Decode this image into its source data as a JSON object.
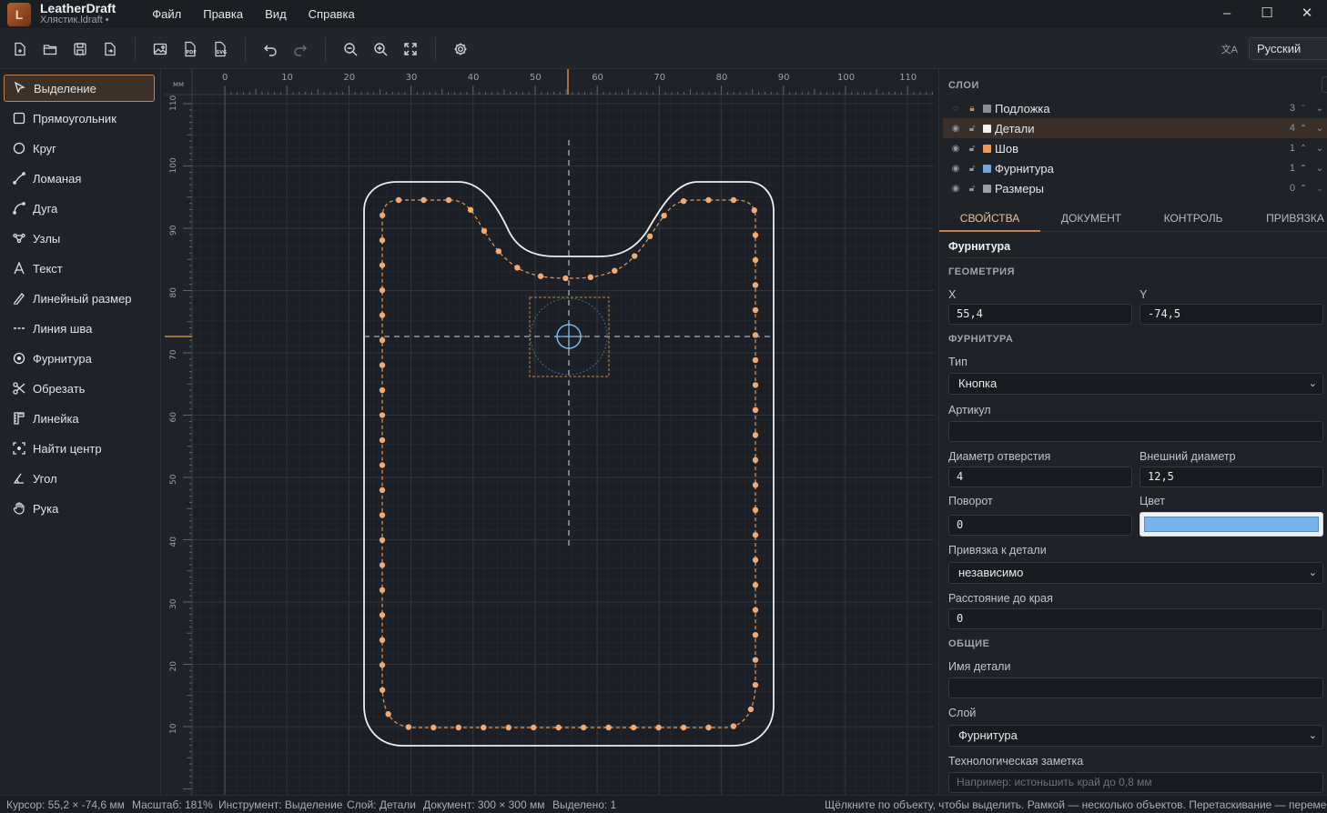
{
  "app": {
    "name": "LeatherDraft",
    "file": "Хлястик.ldraft •"
  },
  "menu": [
    "Файл",
    "Правка",
    "Вид",
    "Справка"
  ],
  "window_buttons": [
    "–",
    "☐",
    "✕"
  ],
  "toolbar": {
    "language": "Русский"
  },
  "tools": [
    "Выделение",
    "Прямоугольник",
    "Круг",
    "Ломаная",
    "Дуга",
    "Узлы",
    "Текст",
    "Линейный размер",
    "Линия шва",
    "Фурнитура",
    "Обрезать",
    "Линейка",
    "Найти центр",
    "Угол",
    "Рука"
  ],
  "ruler": {
    "unit": "мм",
    "x_ticks": [
      "0",
      "10",
      "20",
      "30",
      "40",
      "50",
      "60",
      "70",
      "80",
      "90",
      "100",
      "110"
    ],
    "y_ticks": [
      "110",
      "100",
      "90",
      "80",
      "70",
      "60",
      "50",
      "40",
      "30",
      "20",
      "10"
    ]
  },
  "layers": {
    "title": "СЛОИ",
    "items": [
      {
        "name": "Подложка",
        "count": "3",
        "color": "#8a8f96"
      },
      {
        "name": "Детали",
        "count": "4",
        "color": "#f2f2f2"
      },
      {
        "name": "Шов",
        "count": "1",
        "color": "#e89a55"
      },
      {
        "name": "Фурнитура",
        "count": "1",
        "color": "#6ea8dd"
      },
      {
        "name": "Размеры",
        "count": "0",
        "color": "#9aa0a8"
      }
    ]
  },
  "tabs": [
    "СВОЙСТВА",
    "ДОКУМЕНТ",
    "КОНТРОЛЬ",
    "ПРИВЯЗКА"
  ],
  "props": {
    "object_type": "Фурнитура",
    "geometry_title": "ГЕОМЕТРИЯ",
    "x_label": "X",
    "x_value": "55,4",
    "y_label": "Y",
    "y_value": "-74,5",
    "hardware_title": "ФУРНИТУРА",
    "type_label": "Тип",
    "type_value": "Кнопка",
    "article_label": "Артикул",
    "article_value": "",
    "hole_label": "Диаметр отверстия",
    "hole_value": "4",
    "outer_label": "Внешний диаметр",
    "outer_value": "12,5",
    "rotation_label": "Поворот",
    "rotation_value": "0",
    "color_label": "Цвет",
    "color_value": "#78b4ec",
    "attach_label": "Привязка к детали",
    "attach_value": "независимо",
    "edge_label": "Расстояние до края",
    "edge_value": "0",
    "common_title": "ОБЩИЕ",
    "part_name_label": "Имя детали",
    "part_name_value": "",
    "layer_label": "Слой",
    "layer_value": "Фурнитура",
    "note_label": "Технологическая заметка",
    "note_placeholder": "Например: истоньшить край до 0,8 мм"
  },
  "status": {
    "cursor": "Курсор: 55,2 × -74,6 мм",
    "zoom": "Масштаб: 181%",
    "tool": "Инструмент: Выделение",
    "layer": "Слой: Детали",
    "document": "Документ: 300 × 300 мм",
    "selected": "Выделено: 1",
    "hint": "Щёлкните по объекту, чтобы выделить. Рамкой — несколько объектов. Перетаскивание — перемещение"
  }
}
